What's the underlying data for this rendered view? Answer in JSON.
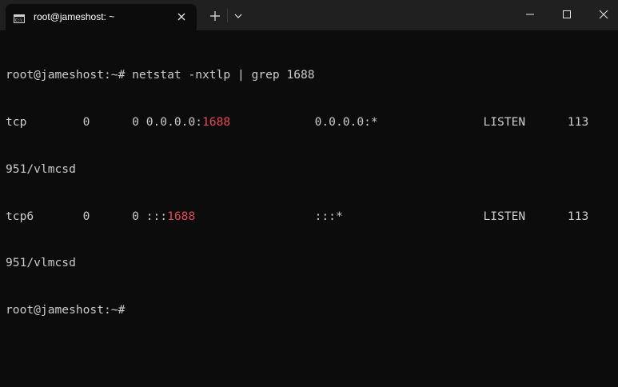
{
  "window": {
    "tab_title": "root@jameshost: ~",
    "tab_icon": "terminal-icon"
  },
  "colors": {
    "background": "#0c0c0c",
    "titlebar": "#202020",
    "text": "#cccccc",
    "match_highlight": "#e74856"
  },
  "terminal": {
    "line1": "root@jameshost:~# netstat -nxtlp | grep 1688",
    "line2_pre": "tcp        0      0 0.0.0.0:",
    "line2_match": "1688",
    "line2_post": "            0.0.0.0:*               LISTEN      113",
    "line3": "951/vlmcsd",
    "line4_pre": "tcp6       0      0 :::",
    "line4_match": "1688",
    "line4_post": "                 :::*                    LISTEN      113",
    "line5": "951/vlmcsd",
    "line6": "root@jameshost:~#"
  }
}
